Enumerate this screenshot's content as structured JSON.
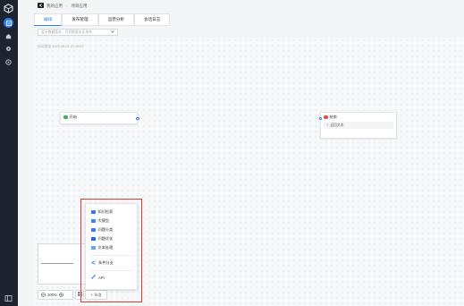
{
  "topbar": {
    "crumb_parent": "我的应用",
    "crumb_sep": "›",
    "crumb_current": "项目应用"
  },
  "tabs": [
    {
      "label": "编排",
      "active": true
    },
    {
      "label": "发布管理",
      "active": false
    },
    {
      "label": "运营分析",
      "active": false
    },
    {
      "label": "会话日志",
      "active": false
    }
  ],
  "toolbar": {
    "select_placeholder": "暂无数据版本，可切换版本至发布",
    "select_icon": "chevron-down-icon"
  },
  "canvas": {
    "save_status": "自动保存 2025-06-01 21:45:53"
  },
  "nodes": {
    "start": {
      "title": "开始",
      "color": "#2fb35a"
    },
    "end": {
      "title": "结束",
      "color": "#e8473c",
      "field": "返回文本"
    }
  },
  "zoom": {
    "level": "100%"
  },
  "add_node": {
    "label": "节点"
  },
  "menu": {
    "items": [
      {
        "label": "知识检索",
        "color": "#2f7cf6"
      },
      {
        "label": "大模型",
        "color": "#3b82f6"
      },
      {
        "label": "问题分类",
        "color": "#2f7cf6"
      },
      {
        "label": "问题优化",
        "color": "#2563eb"
      },
      {
        "label": "文本处理",
        "color": "#60a5fa"
      }
    ],
    "group2": [
      {
        "label": "条件分支",
        "color": "#2f7cf6"
      }
    ],
    "group3": [
      {
        "label": "API",
        "color": "#2f7cf6"
      }
    ]
  },
  "colors": {
    "accent": "#2f7cf6",
    "sidebar": "#1c2431",
    "highlight": "#e23b3b"
  }
}
